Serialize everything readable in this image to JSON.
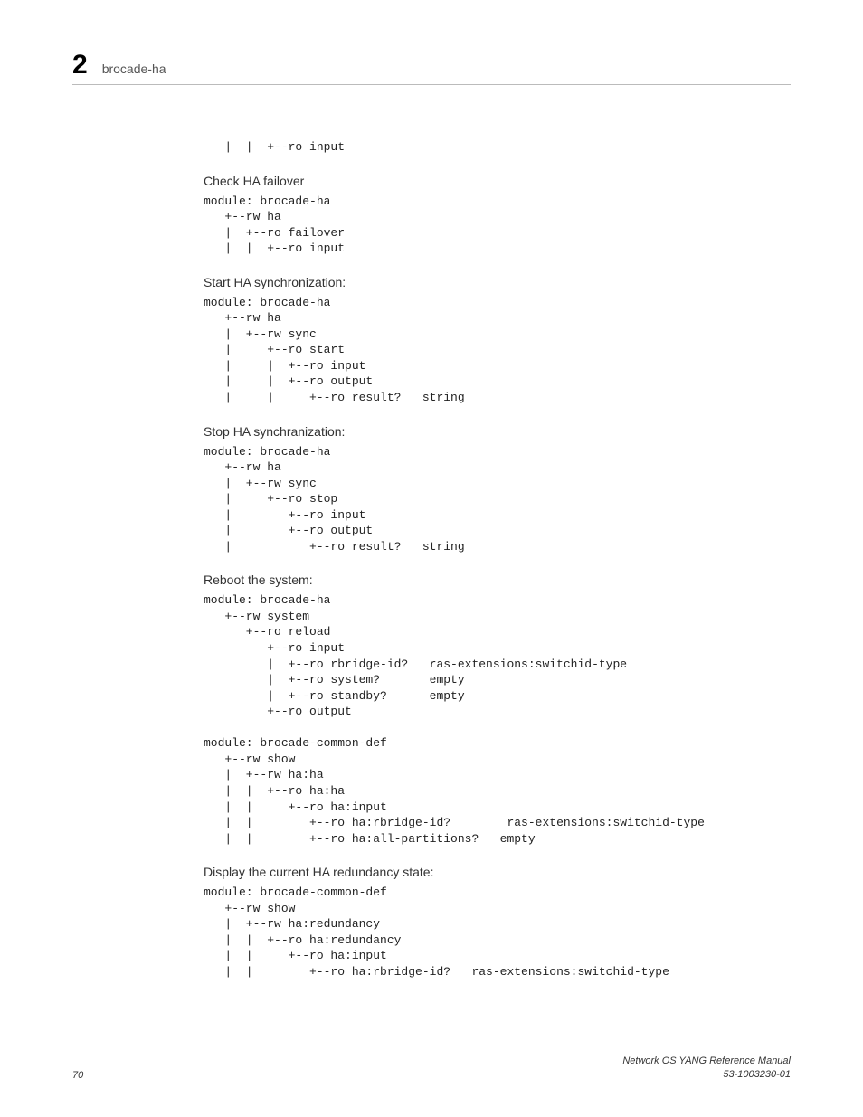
{
  "header": {
    "chapter_number": "2",
    "chapter_title": "brocade-ha"
  },
  "blocks": {
    "pre_intro": "   |  |  +--ro input",
    "check_failover": {
      "heading": "Check HA failover",
      "code": "module: brocade-ha\n   +--rw ha\n   |  +--ro failover\n   |  |  +--ro input"
    },
    "start_sync": {
      "heading": "Start HA synchronization:",
      "code": "module: brocade-ha\n   +--rw ha\n   |  +--rw sync\n   |     +--ro start\n   |     |  +--ro input\n   |     |  +--ro output\n   |     |     +--ro result?   string"
    },
    "stop_sync": {
      "heading": "Stop HA synchranization:",
      "code": "module: brocade-ha\n   +--rw ha\n   |  +--rw sync\n   |     +--ro stop\n   |        +--ro input\n   |        +--ro output\n   |           +--ro result?   string"
    },
    "reboot": {
      "heading": "Reboot the system:",
      "code": "module: brocade-ha\n   +--rw system\n      +--ro reload\n         +--ro input\n         |  +--ro rbridge-id?   ras-extensions:switchid-type\n         |  +--ro system?       empty\n         |  +--ro standby?      empty\n         +--ro output\n\nmodule: brocade-common-def\n   +--rw show\n   |  +--rw ha:ha\n   |  |  +--ro ha:ha\n   |  |     +--ro ha:input\n   |  |        +--ro ha:rbridge-id?        ras-extensions:switchid-type\n   |  |        +--ro ha:all-partitions?   empty"
    },
    "display_state": {
      "heading": "Display the current HA redundancy state:",
      "code": "module: brocade-common-def\n   +--rw show\n   |  +--rw ha:redundancy\n   |  |  +--ro ha:redundancy\n   |  |     +--ro ha:input\n   |  |        +--ro ha:rbridge-id?   ras-extensions:switchid-type"
    }
  },
  "footer": {
    "page_number": "70",
    "right_line1": "Network OS YANG Reference Manual",
    "right_line2": "53-1003230-01"
  }
}
